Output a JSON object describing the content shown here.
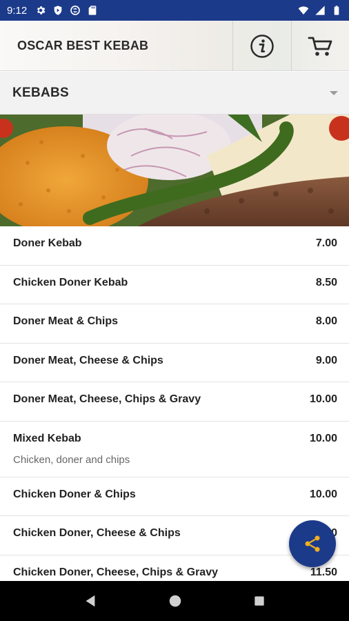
{
  "status_bar": {
    "time": "9:12",
    "left_icons": [
      "gear-icon",
      "shield-icon",
      "sync-icon",
      "sd-card-icon"
    ],
    "right_icons": [
      "wifi-icon",
      "signal-icon",
      "battery-icon"
    ]
  },
  "header": {
    "title": "OSCAR BEST KEBAB",
    "info_icon": "info-icon",
    "cart_icon": "cart-icon"
  },
  "category": {
    "selected": "KEBABS"
  },
  "menu_items": [
    {
      "name": "Doner Kebab",
      "price": "7.00",
      "description": ""
    },
    {
      "name": "Chicken Doner Kebab",
      "price": "8.50",
      "description": ""
    },
    {
      "name": "Doner Meat & Chips",
      "price": "8.00",
      "description": ""
    },
    {
      "name": "Doner Meat, Cheese & Chips",
      "price": "9.00",
      "description": ""
    },
    {
      "name": "Doner Meat, Cheese, Chips & Gravy",
      "price": "10.00",
      "description": ""
    },
    {
      "name": "Mixed Kebab",
      "price": "10.00",
      "description": "Chicken, doner and chips"
    },
    {
      "name": "Chicken Doner & Chips",
      "price": "10.00",
      "description": ""
    },
    {
      "name": "Chicken Doner, Cheese & Chips",
      "price": "10.50",
      "description": ""
    },
    {
      "name": "Chicken Doner, Cheese, Chips & Gravy",
      "price": "11.50",
      "description": ""
    }
  ],
  "colors": {
    "primary": "#1c3a8a",
    "text": "#222222",
    "muted": "#666666"
  },
  "nav": {
    "icons": [
      "back-icon",
      "home-icon",
      "recents-icon"
    ]
  },
  "fab_icon": "share-icon"
}
